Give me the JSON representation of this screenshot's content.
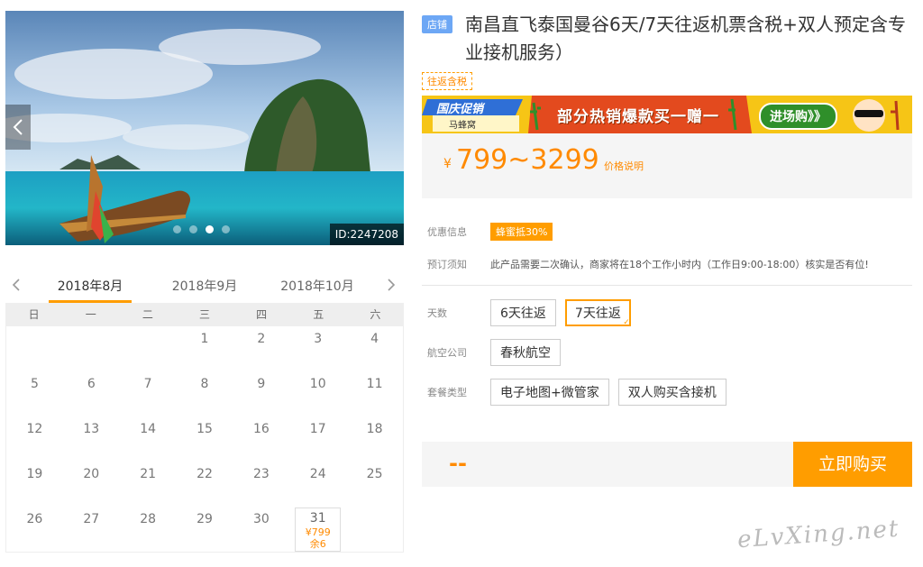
{
  "gallery": {
    "image_id": "ID:2247208",
    "dots": 4,
    "active_dot": 2
  },
  "calendar": {
    "months": [
      "2018年8月",
      "2018年9月",
      "2018年10月"
    ],
    "active_month": 0,
    "weekdays": [
      "日",
      "一",
      "二",
      "三",
      "四",
      "五",
      "六"
    ],
    "rows": [
      [
        "",
        "",
        "",
        "1",
        "2",
        "3",
        "4"
      ],
      [
        "5",
        "6",
        "7",
        "8",
        "9",
        "10",
        "11"
      ],
      [
        "12",
        "13",
        "14",
        "15",
        "16",
        "17",
        "18"
      ],
      [
        "19",
        "20",
        "21",
        "22",
        "23",
        "24",
        "25"
      ],
      [
        "26",
        "27",
        "28",
        "29",
        "30",
        "31",
        ""
      ]
    ],
    "priced_day": {
      "day": "31",
      "price": "¥799",
      "stock": "余6"
    }
  },
  "product": {
    "shop_badge": "店铺",
    "title": "南昌直飞泰国曼谷6天/7天往返机票含税+双人预定含专业接机服务）",
    "tag": "往返含税"
  },
  "banner": {
    "brand": "国庆促销",
    "sub": "马蜂窝",
    "main": "部分热销爆款买一赠一",
    "go": "进场购》》",
    "bg_color": "#f6c516"
  },
  "price": {
    "currency": "¥",
    "range": "799~3299",
    "explain": "价格说明",
    "accent": "#ff8a00"
  },
  "info": {
    "promo_label": "优惠信息",
    "promo_tag": "蜂蜜抵30%",
    "notice_label": "预订须知",
    "notice_text": "此产品需要二次确认，商家将在18个工作小时内（工作日9:00-18:00）核实是否有位!"
  },
  "options": {
    "days_label": "天数",
    "days": [
      "6天往返",
      "7天往返"
    ],
    "days_selected": 1,
    "airline_label": "航空公司",
    "airlines": [
      "春秋航空"
    ],
    "package_label": "套餐类型",
    "packages": [
      "电子地图+微管家",
      "双人购买含接机"
    ]
  },
  "buy": {
    "total": "--",
    "button": "立即购买",
    "button_color": "#ff9d00"
  },
  "watermark": "eLvXing.net"
}
